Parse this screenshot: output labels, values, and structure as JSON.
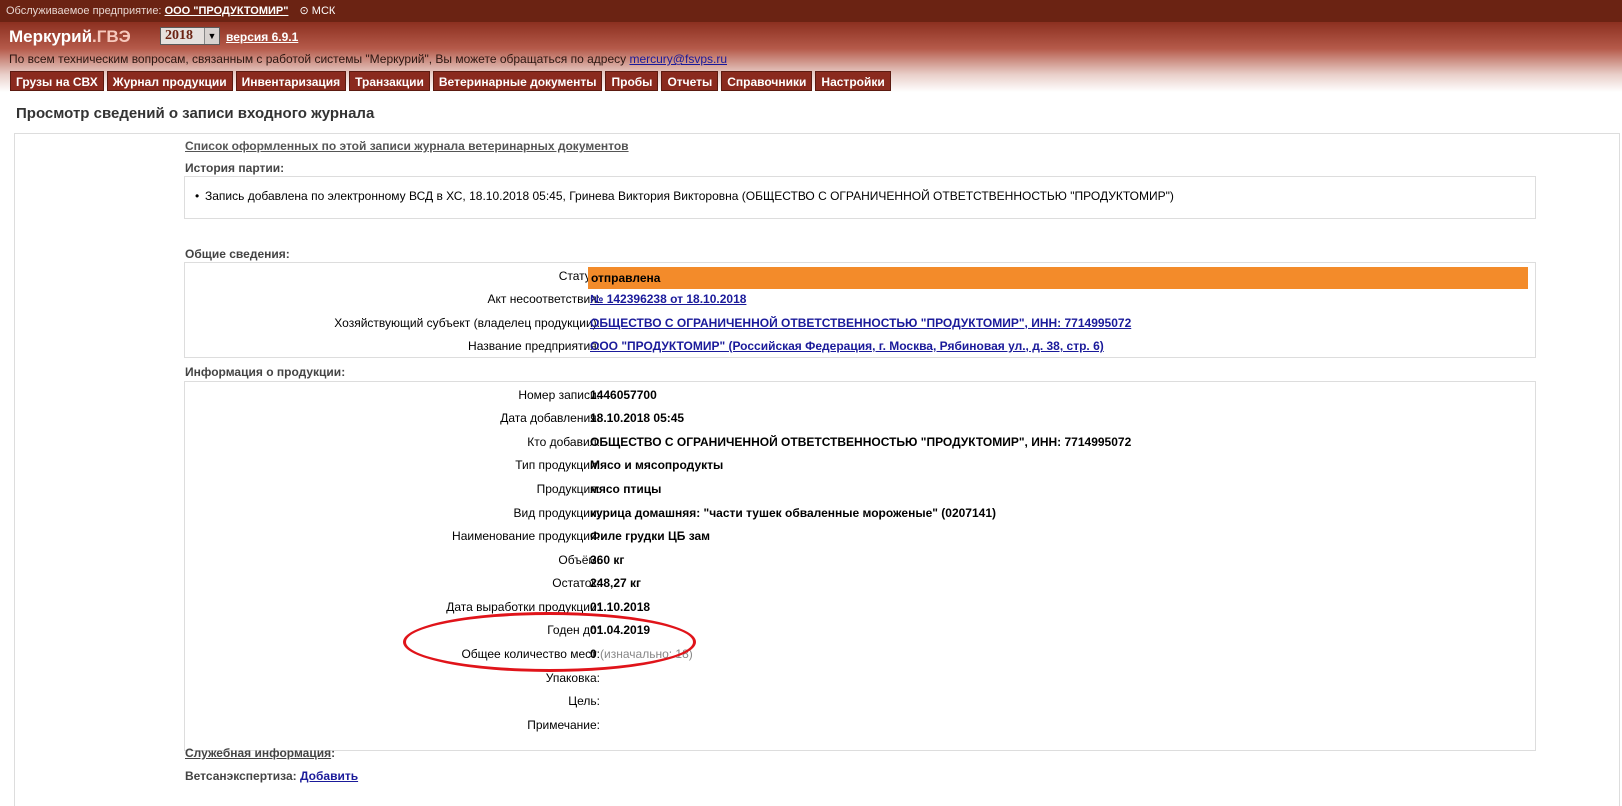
{
  "topbar": {
    "enterprise_label": "Обслуживаемое предприятие:",
    "enterprise_name": "ООО \"ПРОДУКТОМИР\"",
    "timezone": "МСК"
  },
  "header": {
    "logo_main": "Меркурий",
    "logo_sub": ".ГВЭ",
    "year": "2018",
    "version": "версия 6.9.1",
    "support_text": "По всем техническим вопросам, связанным с работой системы \"Меркурий\", Вы можете обращаться по адресу",
    "support_email": "mercury@fsvps.ru"
  },
  "nav": {
    "tabs": [
      "Грузы на СВХ",
      "Журнал продукции",
      "Инвентаризация",
      "Транзакции",
      "Ветеринарные документы",
      "Пробы",
      "Отчеты",
      "Справочники",
      "Настройки"
    ]
  },
  "page": {
    "title": "Просмотр сведений о записи входного журнала",
    "vet_docs_link": "Список оформленных по этой записи журнала ветеринарных документов",
    "history_heading": "История партии:",
    "history_item": "Запись добавлена по электронному ВСД в ХС, 18.10.2018 05:45, Гринева Виктория Викторовна (ОБЩЕСТВО С ОГРАНИЧЕННОЙ ОТВЕТСТВЕННОСТЬЮ \"ПРОДУКТОМИР\")",
    "general_heading": "Общие сведения:",
    "general": {
      "status_label": "Статус:",
      "status_value": "отправлена",
      "act_label": "Акт несоответствия:",
      "act_value": "№ 142396238 от 18.10.2018",
      "owner_label": "Хозяйствующий субъект (владелец продукции):",
      "owner_value": "ОБЩЕСТВО С ОГРАНИЧЕННОЙ ОТВЕТСТВЕННОСТЬЮ \"ПРОДУКТОМИР\", ИНН: 7714995072",
      "enterprise_label": "Название предприятия:",
      "enterprise_value": "ООО \"ПРОДУКТОМИР\" (Российская Федерация, г. Москва, Рябиновая ул., д. 38, стр. 6)"
    },
    "product_heading": "Информация о продукции:",
    "product": {
      "record_no_label": "Номер записи:",
      "record_no_value": "1446057700",
      "date_added_label": "Дата добавления:",
      "date_added_value": "18.10.2018 05:45",
      "added_by_label": "Кто добавил:",
      "added_by_value": "ОБЩЕСТВО С ОГРАНИЧЕННОЙ ОТВЕТСТВЕННОСТЬЮ \"ПРОДУКТОМИР\", ИНН: 7714995072",
      "type_label": "Тип продукции:",
      "type_value": "Мясо и мясопродукты",
      "product_label": "Продукция:",
      "product_value": "мясо птицы",
      "kind_label": "Вид продукции:",
      "kind_value": "курица домашняя: \"части тушек обваленные мороженые\" (0207141)",
      "name_label": "Наименование продукции:",
      "name_value": "Филе грудки ЦБ зам",
      "volume_label": "Объём:",
      "volume_value": "360 кг",
      "remain_label": "Остаток:",
      "remain_value": "248,27 кг",
      "prod_date_label": "Дата выработки продукции:",
      "prod_date_value": "01.10.2018",
      "expiry_label": "Годен до:",
      "expiry_value": "01.04.2019",
      "places_label": "Общее количество мест:",
      "places_value": "0",
      "places_initial": "(изначально: 18)",
      "package_label": "Упаковка:",
      "purpose_label": "Цель:",
      "note_label": "Примечание:"
    },
    "service_info_link": "Служебная информация",
    "service_info_colon": ":",
    "vetexam_label": "Ветсанэкспертиза:",
    "vetexam_add": "Добавить"
  },
  "colors": {
    "topbar": "#6b2313",
    "tab": "#8a2a1e",
    "status_highlight": "#f38b2a",
    "annotation_ellipse": "#e0141a",
    "link": "#1a1a9a"
  }
}
